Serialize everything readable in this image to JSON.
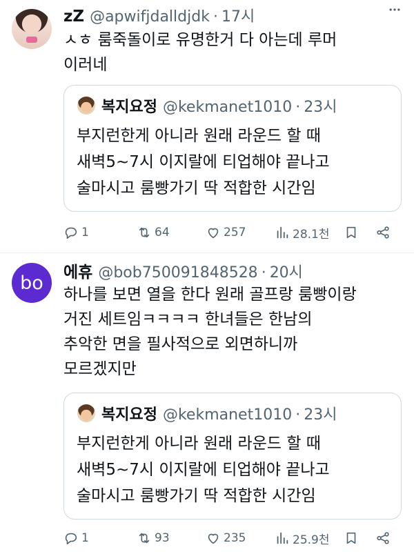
{
  "tweets": [
    {
      "avatar_type": "photo",
      "name": "zZ",
      "handle": "@apwifjdalldjdk",
      "time": "17시",
      "text": "ㅅㅎ 룸죽돌이로 유명한거 다 아는데 루머\n이러네",
      "quote": {
        "name": "복지요정",
        "handle": "@kekmanet1010",
        "time": "23시",
        "text": "부지런한게 아니라 원래 라운드 할 때\n새벽5~7시 이지랄에 티업해야 끝나고\n술마시고 룸빵가기 딱 적합한 시간임"
      },
      "actions": {
        "reply": "1",
        "retweet": "64",
        "like": "257",
        "views": "28.1천"
      }
    },
    {
      "avatar_type": "initials",
      "avatar_text": "bo",
      "avatar_color": "#5b2bd1",
      "name": "에휴",
      "handle": "@bob750091848528",
      "time": "20시",
      "text": "하나를 보면 열을 한다 원래 골프랑 룸빵이랑\n거진 세트임ㅋㅋㅋㅋ 한녀들은 한남의\n추악한 면을 필사적으로 외면하니까\n모르겠지만",
      "quote": {
        "name": "복지요정",
        "handle": "@kekmanet1010",
        "time": "23시",
        "text": "부지런한게 아니라 원래 라운드 할 때\n새벽5~7시 이지랄에 티업해야 끝나고\n술마시고 룸빵가기 딱 적합한 시간임"
      },
      "actions": {
        "reply": "1",
        "retweet": "93",
        "like": "235",
        "views": "25.9천"
      }
    }
  ],
  "separator": "·",
  "icons": [
    "more-icon",
    "reply-icon",
    "retweet-icon",
    "like-icon",
    "views-icon",
    "bookmark-icon",
    "share-icon"
  ]
}
